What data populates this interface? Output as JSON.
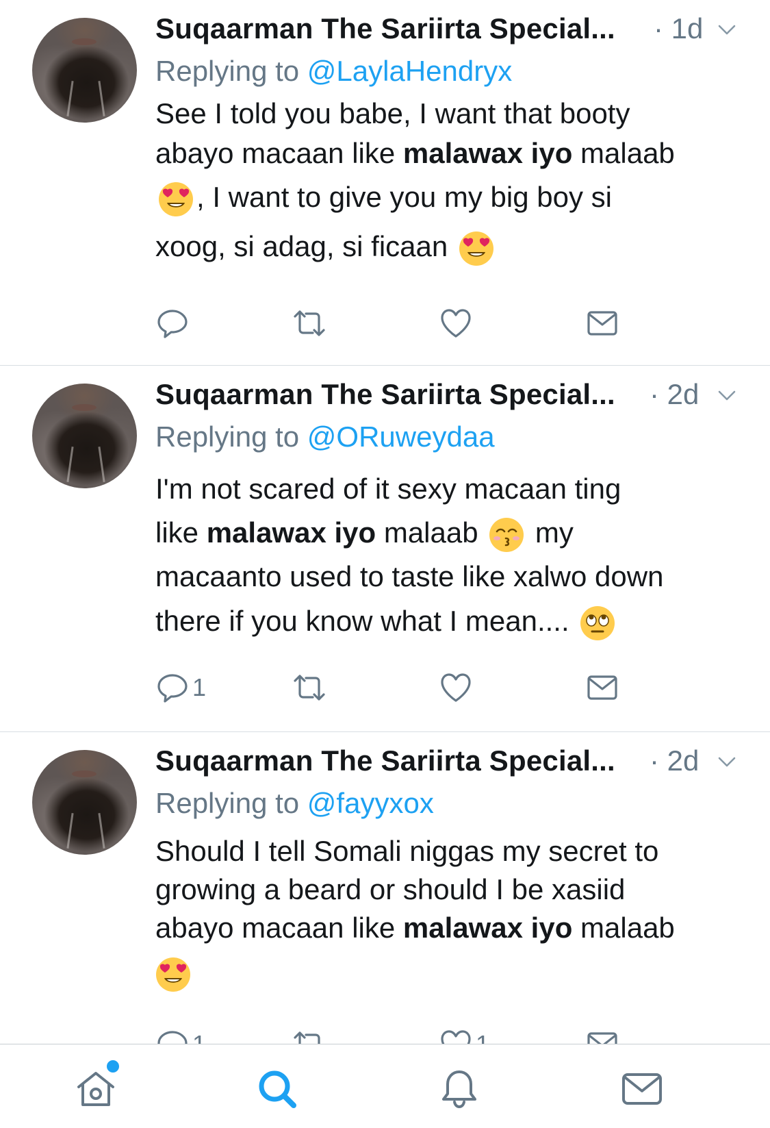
{
  "colors": {
    "accent": "#1da1f2",
    "secondary_text": "#657786",
    "primary_text": "#14171a"
  },
  "tweets": [
    {
      "author": "Suqaarman The Sariirta Special...",
      "time": "· 1d",
      "replying_label": "Replying to",
      "handle": "@LaylaHendryx",
      "lines": [
        [
          "See I told you babe, I want that booty"
        ],
        [
          "abayo macaan like ",
          "malawax iyo",
          " malaab"
        ],
        [
          ", I want to give you my big boy si"
        ],
        [
          "xoog, si adag, si ficaan "
        ]
      ],
      "emoji": [
        "heart-eyes-emoji",
        "heart-eyes-emoji"
      ],
      "reply_count": "",
      "retweet_count": "",
      "like_count": ""
    },
    {
      "author": "Suqaarman The Sariirta Special...",
      "time": "· 2d",
      "replying_label": "Replying to",
      "handle": "@ORuweydaa",
      "lines": [
        [
          "I'm not scared of it sexy macaan ting"
        ],
        [
          "like ",
          "malawax iyo",
          " malaab ",
          " my"
        ],
        [
          "macaanto used to taste like xalwo down"
        ],
        [
          "there if you know what I mean.... "
        ]
      ],
      "emoji": [
        "kissing-emoji",
        "eye-roll-emoji"
      ],
      "reply_count": "1",
      "retweet_count": "",
      "like_count": ""
    },
    {
      "author": "Suqaarman The Sariirta Special...",
      "time": "· 2d",
      "replying_label": "Replying to",
      "handle": "@fayyxox",
      "lines": [
        [
          "Should I tell Somali niggas my secret to"
        ],
        [
          "growing a beard or should I be xasiid"
        ],
        [
          "abayo macaan like ",
          "malawax iyo",
          " malaab"
        ]
      ],
      "emoji": [
        "heart-eyes-emoji"
      ],
      "reply_count": "1",
      "retweet_count": "",
      "like_count": "1"
    }
  ],
  "tabbar": [
    "home-icon",
    "search-icon",
    "notifications-icon",
    "messages-icon"
  ]
}
